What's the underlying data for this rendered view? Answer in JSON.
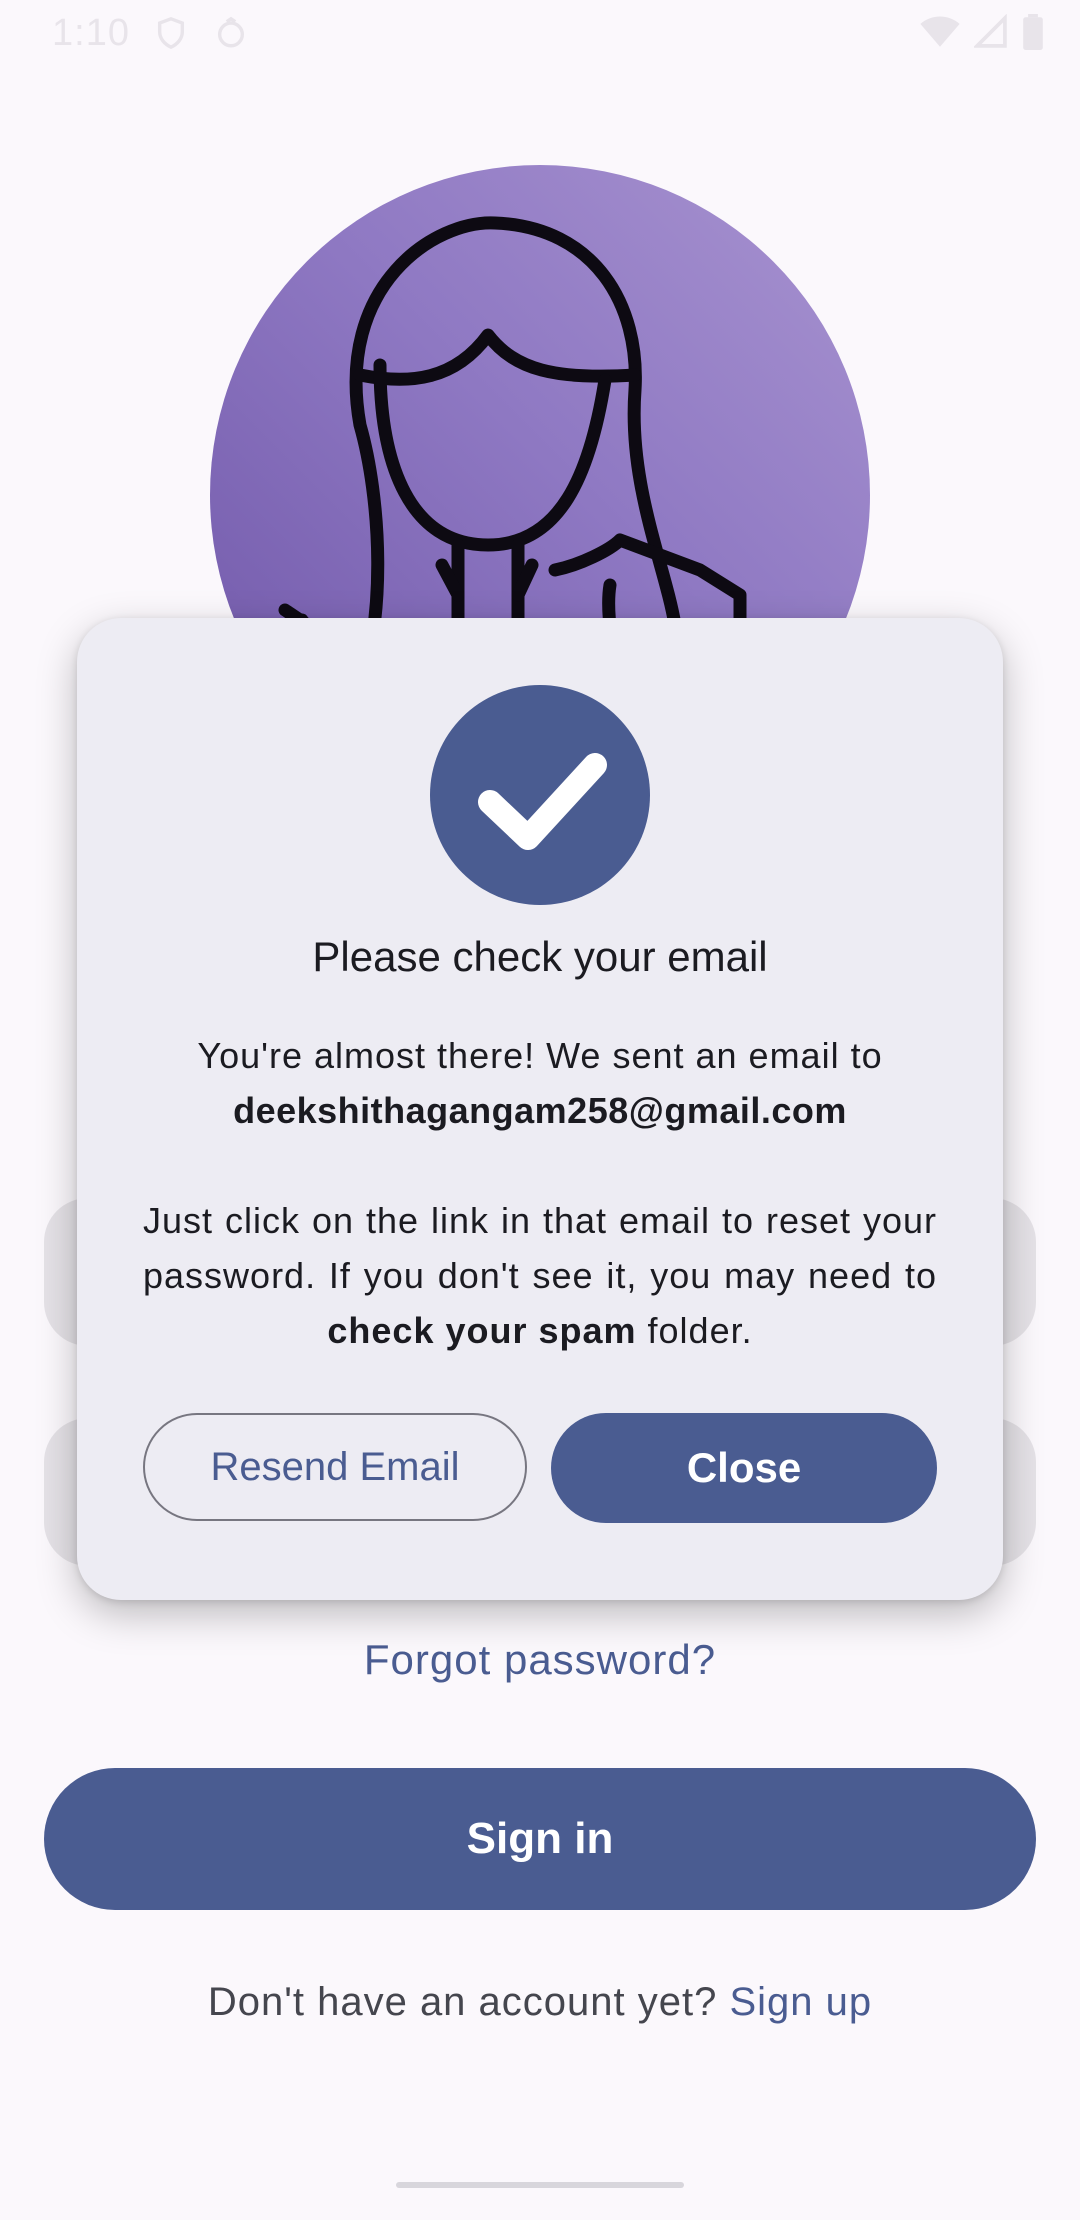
{
  "status_bar": {
    "time": "1:10",
    "left_icons": [
      "shield-icon",
      "data-saver-icon"
    ],
    "right_icons": [
      "wifi-icon",
      "signal-icon",
      "battery-icon"
    ]
  },
  "avatar": {
    "icon": "woman-avatar-icon",
    "gradient": [
      "#a893d0",
      "#6f56a8"
    ]
  },
  "dialog": {
    "icon": "check-icon",
    "title": "Please check your email",
    "line1": "You're almost there! We sent an email to",
    "email": "deekshithagangam258@gmail.com",
    "p2_a": "Just click on the link in that email to reset your password. If you don't see it, you may need to ",
    "p2_bold": "check your spam",
    "p2_b": " folder.",
    "resend_label": "Resend Email",
    "close_label": "Close"
  },
  "login": {
    "forgot_password": "Forgot password?",
    "sign_in": "Sign in",
    "no_account": "Don't have an account yet? ",
    "sign_up": "Sign up"
  },
  "colors": {
    "primary": "#4a5c91",
    "background": "#fbf8fc",
    "dialog_bg": "#edecf3",
    "field_bg": "#e5e2e7"
  }
}
